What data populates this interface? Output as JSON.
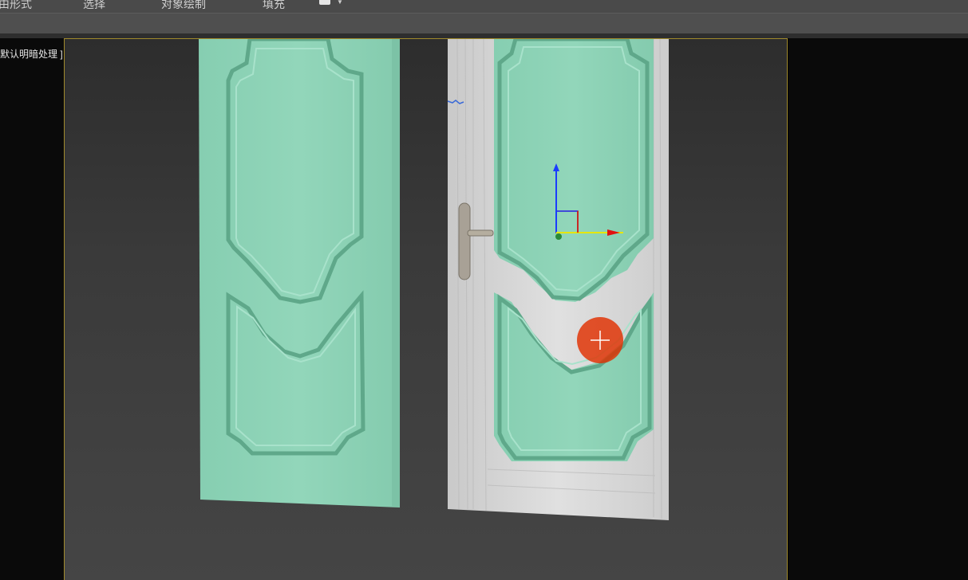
{
  "menubar": {
    "items": [
      {
        "label": "由形式"
      },
      {
        "label": "选择"
      },
      {
        "label": "对象绘制"
      },
      {
        "label": "填充"
      }
    ],
    "dropdown_icon": "paint-swatch-icon"
  },
  "viewport": {
    "label": "默认明暗处理 ]"
  },
  "colors": {
    "door_panel": "#8fd4b8",
    "door_frame": "#d5d5d5",
    "viewport_border": "#a08a2c",
    "gizmo_x": "#e01010",
    "gizmo_y": "#e6e600",
    "gizmo_z": "#1a3cff",
    "cursor_marker": "#e03000"
  },
  "icons": {
    "gizmo": "transform-gizmo-icon",
    "cursor": "crosshair-cursor-icon"
  }
}
